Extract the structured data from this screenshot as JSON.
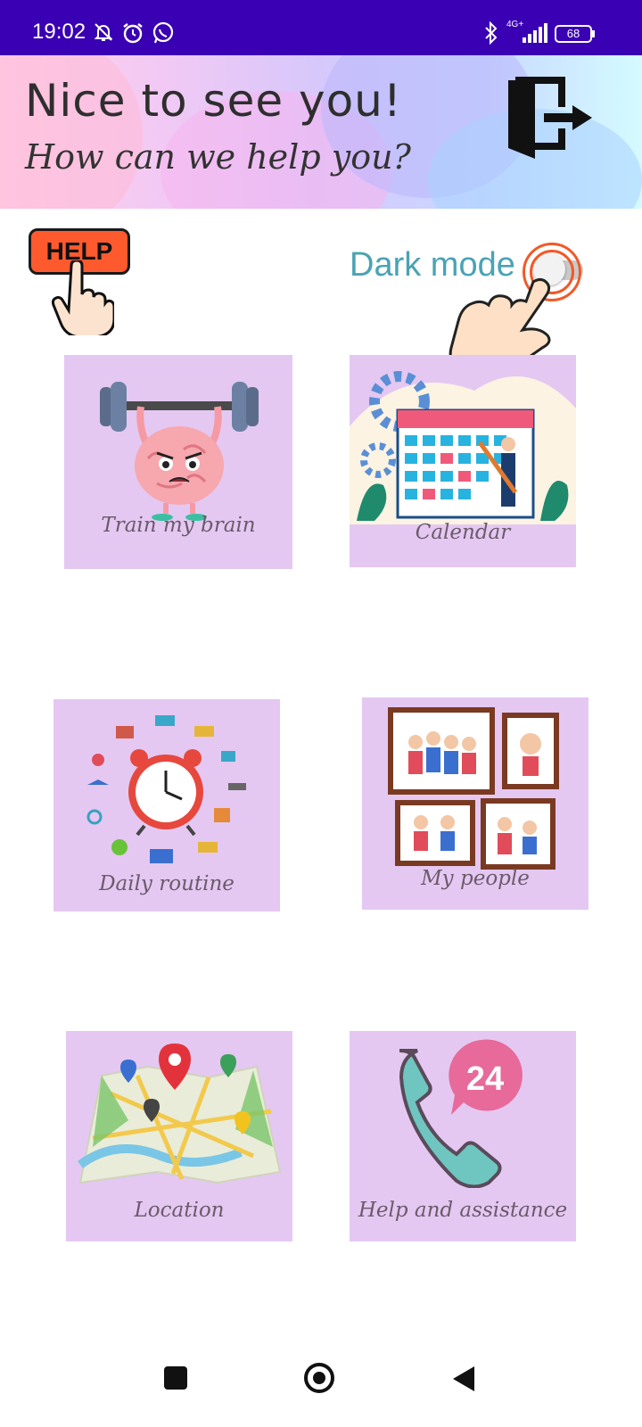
{
  "status_bar": {
    "time": "19:02",
    "left_icons": [
      "mute-bell-icon",
      "alarm-icon",
      "whatsapp-icon"
    ],
    "right_icons": [
      "bluetooth-icon",
      "network-4g-icon",
      "signal-icon",
      "battery-icon"
    ],
    "network_label": "4G+",
    "battery_level": "68"
  },
  "header": {
    "title": "Nice to see you!",
    "subtitle": "How can we help you?",
    "exit_icon": "logout-door-icon"
  },
  "help": {
    "label": "HELP",
    "icon": "pointing-hand-icon"
  },
  "dark_mode": {
    "label": "Dark mode",
    "enabled": false
  },
  "tiles": [
    {
      "label": "Train my brain",
      "icon": "brain-weightlifting-icon"
    },
    {
      "label": "Calendar",
      "icon": "calendar-illustration-icon"
    },
    {
      "label": "Daily routine",
      "icon": "alarm-clock-routine-icon"
    },
    {
      "label": "My people",
      "icon": "family-photo-frames-icon"
    },
    {
      "label": "Location",
      "icon": "map-pins-icon"
    },
    {
      "label": "Help and assistance",
      "icon": "phone-24-icon"
    }
  ],
  "nav_bar": {
    "items": [
      "recents-square-icon",
      "home-circle-icon",
      "back-triangle-icon"
    ]
  },
  "colors": {
    "status_bar": "#3a00b3",
    "tile_background": "#e4c8f2",
    "dark_mode_text": "#4aa3b4",
    "help_button": "#ff5a2e"
  }
}
